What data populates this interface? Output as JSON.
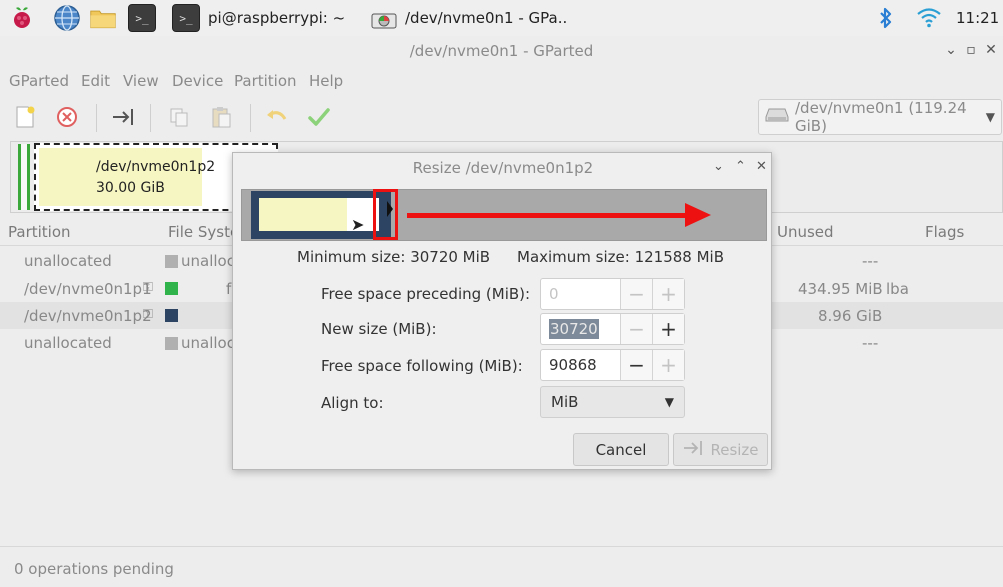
{
  "taskbar": {
    "terminal_glyph": ">_",
    "terminal_title": "pi@raspberrypi: ~",
    "gparted_title": "/dev/nvme0n1 - GPa..",
    "clock": "11:21",
    "icons": [
      "raspberry-pi-logo-icon",
      "web-browser-icon",
      "file-manager-icon",
      "terminal-icon",
      "bluetooth-icon",
      "wifi-icon"
    ]
  },
  "window": {
    "title": "/dev/nvme0n1 - GParted",
    "controls": {
      "minimize": "⌄",
      "maximize": "▫",
      "close": "✕"
    }
  },
  "menubar": [
    "GParted",
    "Edit",
    "View",
    "Device",
    "Partition",
    "Help"
  ],
  "toolbar": {
    "device_selector": "/dev/nvme0n1 (119.24 GiB)"
  },
  "disk_graphic": {
    "selected_partition": "/dev/nvme0n1p2",
    "selected_size": "30.00 GiB"
  },
  "table": {
    "headers": {
      "partition": "Partition",
      "filesystem": "File Syste",
      "unused": "Unused",
      "flags": "Flags"
    },
    "rows": [
      {
        "partition": "unallocated",
        "filesystem": "unalloc",
        "unused": "---",
        "flags": "",
        "swatch": "#b0b0b0"
      },
      {
        "partition": "/dev/nvme0n1p1",
        "filesystem": "f",
        "unused": "434.95 MiB",
        "flags": "lba",
        "swatch": "#2fb34a"
      },
      {
        "partition": "/dev/nvme0n1p2",
        "filesystem": "",
        "unused": "8.96 GiB",
        "flags": "",
        "swatch": "#2d4563"
      },
      {
        "partition": "unallocated",
        "filesystem": "unalloc",
        "unused": "---",
        "flags": "",
        "swatch": "#b0b0b0"
      }
    ]
  },
  "status": "0 operations pending",
  "dialog": {
    "title": "Resize /dev/nvme0n1p2",
    "min_size": "Minimum size: 30720 MiB",
    "max_size": "Maximum size: 121588 MiB",
    "fields": {
      "free_preceding": {
        "label": "Free space preceding (MiB):",
        "value": "0"
      },
      "new_size": {
        "label": "New size (MiB):",
        "value": "30720"
      },
      "free_following": {
        "label": "Free space following (MiB):",
        "value": "90868"
      },
      "align": {
        "label": "Align to:",
        "value": "MiB"
      }
    },
    "buttons": {
      "cancel": "Cancel",
      "resize": "Resize"
    }
  }
}
